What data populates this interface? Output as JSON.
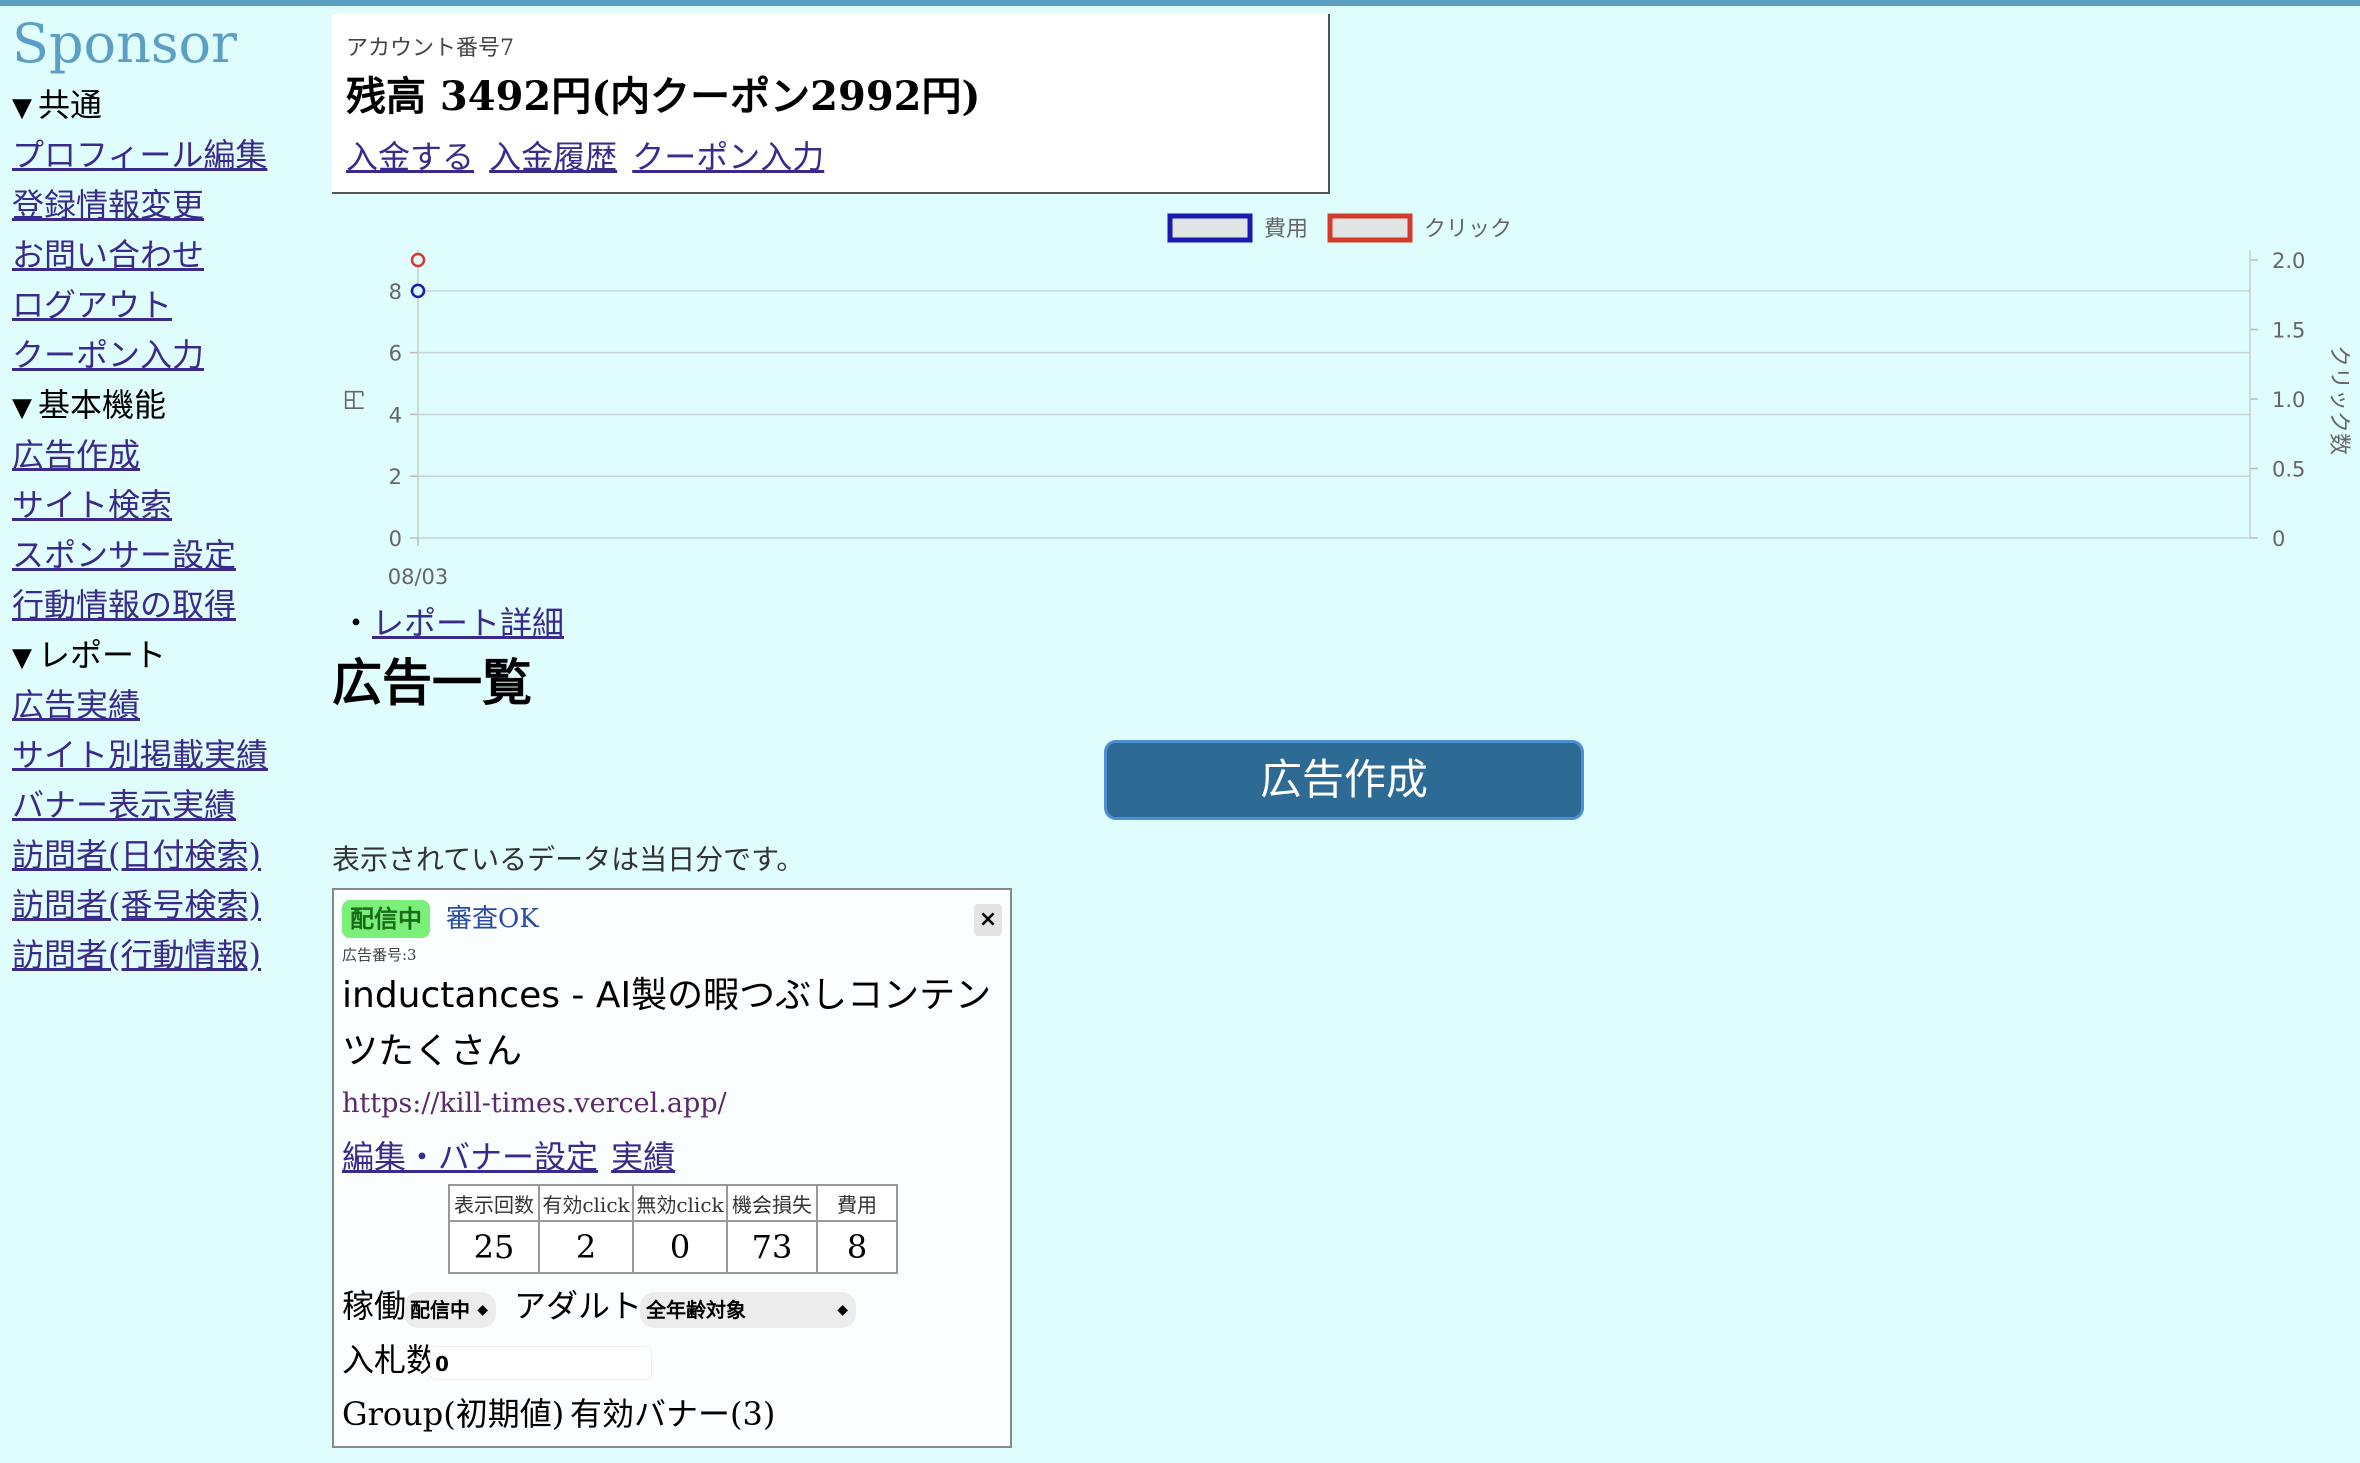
{
  "sidebar": {
    "logo": "Sponsor",
    "sections": [
      {
        "title": "共通",
        "items": [
          "プロフィール編集",
          "登録情報変更",
          "お問い合わせ",
          "ログアウト",
          "クーポン入力"
        ]
      },
      {
        "title": "基本機能",
        "items": [
          "広告作成",
          "サイト検索",
          "スポンサー設定",
          "行動情報の取得"
        ]
      },
      {
        "title": "レポート",
        "items": [
          "広告実績",
          "サイト別掲載実績",
          "バナー表示実績",
          "訪問者(日付検索)",
          "訪問者(番号検索)",
          "訪問者(行動情報)"
        ]
      }
    ]
  },
  "account": {
    "number_label": "アカウント番号7",
    "balance_text": "残高 3492円(内クーポン2992円)",
    "links": [
      "入金する",
      "入金履歴",
      "クーポン入力"
    ]
  },
  "chart_data": {
    "type": "line",
    "x": [
      "08/03"
    ],
    "series": [
      {
        "name": "費用",
        "axis": "left",
        "values": [
          8
        ],
        "color": "#1a1ab0"
      },
      {
        "name": "クリック",
        "axis": "right",
        "values": [
          2
        ],
        "color": "#d43a2a"
      }
    ],
    "ylabel": "円",
    "ylabel_right": "クリック数",
    "ylim": [
      0,
      9
    ],
    "ylim_right": [
      0,
      2.0
    ],
    "yticks": [
      "0",
      "2",
      "4",
      "6",
      "8"
    ],
    "yticks_right": [
      "0",
      "0.5",
      "1.0",
      "1.5",
      "2.0"
    ],
    "legend_position": "top-center",
    "grid": true
  },
  "report_detail_bullet": "・",
  "report_detail_link": "レポート詳細",
  "ads_title": "広告一覧",
  "create_button_label": "広告作成",
  "data_note": "表示されているデータは当日分です。",
  "ad": {
    "status_badge": "配信中",
    "review_status": "審査OK",
    "close_label": "×",
    "ad_number": "広告番号:3",
    "title": "inductances - AI製の暇つぶしコンテンツたくさん",
    "url": "https://kill-times.vercel.app/",
    "links": [
      "編集・バナー設定",
      "実績"
    ],
    "stats": {
      "headers": [
        "表示回数",
        "有効click",
        "無効click",
        "機会損失",
        "費用"
      ],
      "values": [
        "25",
        "2",
        "0",
        "73",
        "8"
      ]
    },
    "operation_label": "稼働",
    "operation_value": "配信中",
    "adult_label": "アダルト",
    "adult_value": "全年齢対象",
    "bid_label": "入札数",
    "bid_value": "0",
    "group_label": "Group(初期値)",
    "banner_label": "有効バナー(3)"
  },
  "icons": {
    "select_arrow": "⌃⌄",
    "section_toggle": "▼"
  }
}
